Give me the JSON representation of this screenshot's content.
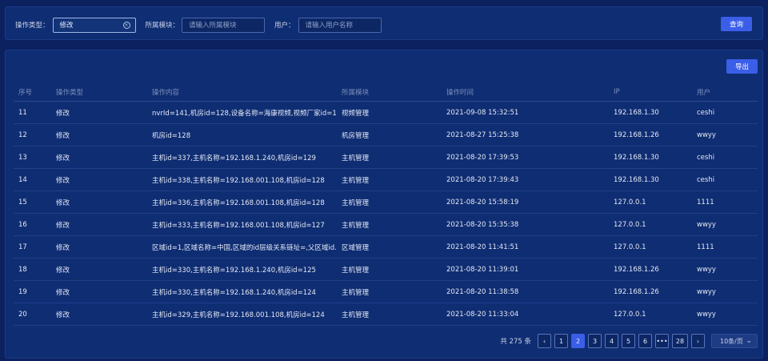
{
  "filters": {
    "op_type_label": "操作类型：",
    "op_type_value": "修改",
    "module_label": "所属模块：",
    "module_placeholder": "请输入所属模块",
    "user_label": "用户：",
    "user_placeholder": "请输入用户名称",
    "query_label": "查询"
  },
  "toolbar": {
    "export_label": "导出"
  },
  "table": {
    "headers": [
      "序号",
      "操作类型",
      "操作内容",
      "所属模块",
      "操作时间",
      "IP",
      "用户"
    ],
    "rows": [
      [
        "11",
        "修改",
        "nvrId=141,机房id=128,设备名称=海康视频,视频厂家id=1,...",
        "视频管理",
        "2021-09-08 15:32:51",
        "192.168.1.30",
        "ceshi"
      ],
      [
        "12",
        "修改",
        "机房id=128",
        "机房管理",
        "2021-08-27 15:25:38",
        "192.168.1.26",
        "wwyy"
      ],
      [
        "13",
        "修改",
        "主机id=337,主机名称=192.168.1.240,机房id=129",
        "主机管理",
        "2021-08-20 17:39:53",
        "192.168.1.30",
        "ceshi"
      ],
      [
        "14",
        "修改",
        "主机id=338,主机名称=192.168.001.108,机房id=128",
        "主机管理",
        "2021-08-20 17:39:43",
        "192.168.1.30",
        "ceshi"
      ],
      [
        "15",
        "修改",
        "主机id=336,主机名称=192.168.001.108,机房id=128",
        "主机管理",
        "2021-08-20 15:58:19",
        "127.0.0.1",
        "1111"
      ],
      [
        "16",
        "修改",
        "主机id=333,主机名称=192.168.001.108,机房id=127",
        "主机管理",
        "2021-08-20 15:35:38",
        "127.0.0.1",
        "wwyy"
      ],
      [
        "17",
        "修改",
        "区域id=1,区域名称=中国,区域的id层级关系链址=,父区域id...",
        "区域管理",
        "2021-08-20 11:41:51",
        "127.0.0.1",
        "1111"
      ],
      [
        "18",
        "修改",
        "主机id=330,主机名称=192.168.1.240,机房id=125",
        "主机管理",
        "2021-08-20 11:39:01",
        "192.168.1.26",
        "wwyy"
      ],
      [
        "19",
        "修改",
        "主机id=330,主机名称=192.168.1.240,机房id=124",
        "主机管理",
        "2021-08-20 11:38:58",
        "192.168.1.26",
        "wwyy"
      ],
      [
        "20",
        "修改",
        "主机id=329,主机名称=192.168.001.108,机房id=124",
        "主机管理",
        "2021-08-20 11:33:04",
        "127.0.0.1",
        "wwyy"
      ]
    ]
  },
  "pagination": {
    "total_text": "共 275 条",
    "prev_icon": "‹",
    "next_icon": "›",
    "pages": [
      "1",
      "2",
      "3",
      "4",
      "5",
      "6",
      "•••",
      "28"
    ],
    "active_index": 1,
    "page_size": "10条/页"
  },
  "icons": {
    "clear": "clear-circle-icon",
    "prev": "chevron-left-icon",
    "next": "chevron-right-icon",
    "select": "chevron-down-icon"
  },
  "colors": {
    "background": "#0b2160",
    "panel": "#0f2d72",
    "primary_button": "#3b5ee8"
  }
}
